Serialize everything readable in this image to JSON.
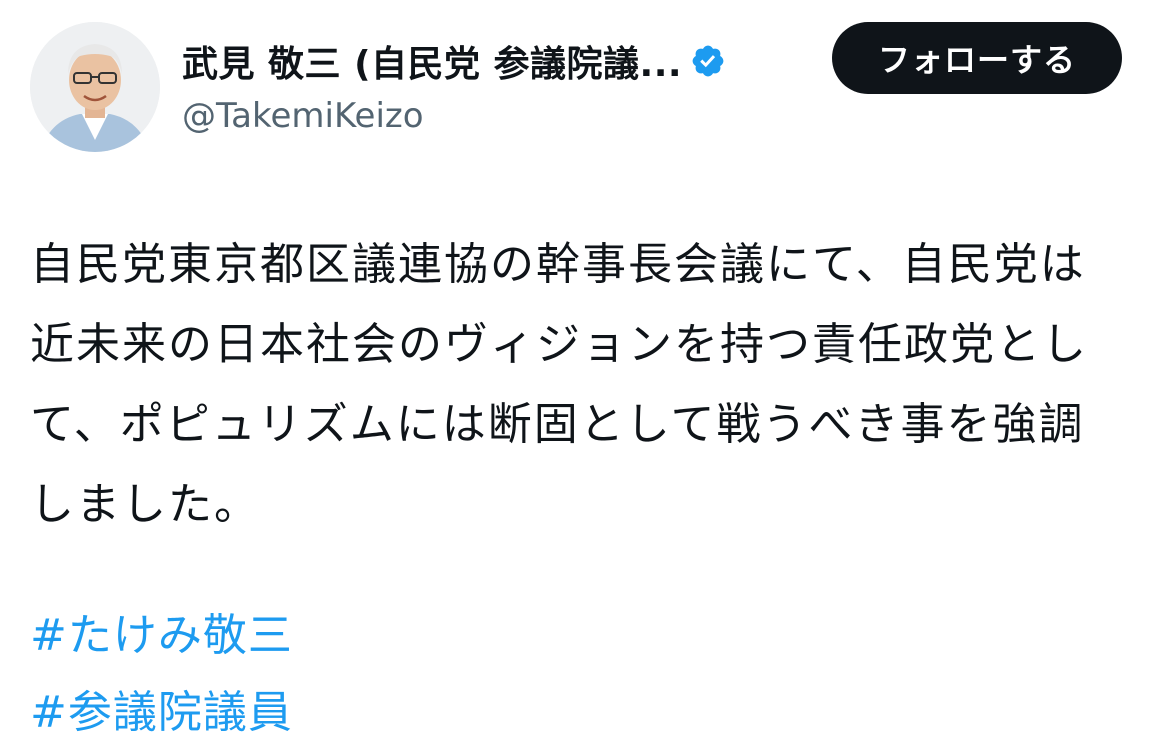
{
  "author": {
    "display_name": "武見 敬三 (自民党 参議院議...",
    "handle": "@TakemiKeizo",
    "verified_icon": "verified-badge-icon",
    "avatar_icon": "profile-photo"
  },
  "follow_button": {
    "label": "フォローする"
  },
  "tweet": {
    "lines": [
      "自民党東京都区議連協の幹事長会議にて、自民党は",
      "近未来の日本社会のヴィジョンを持つ責任政党とし",
      "て、ポピュリズムには断固として戦うべき事を強調",
      "しました。"
    ],
    "hashtags": [
      "#たけみ敬三",
      "#参議院議員"
    ]
  },
  "colors": {
    "text": "#0f1419",
    "secondary": "#536471",
    "link": "#1d9bf0",
    "verified": "#1d9bf0",
    "button_bg": "#0f1419",
    "button_text": "#ffffff"
  }
}
